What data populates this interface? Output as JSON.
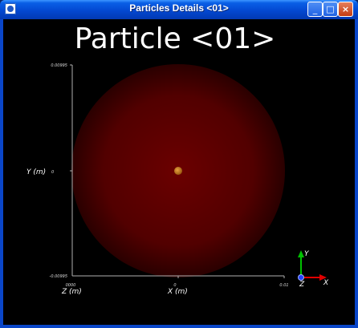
{
  "window": {
    "title": "Particles Details <01>",
    "controls": {
      "minimize": "_",
      "maximize": "□",
      "close": "×"
    }
  },
  "viewport": {
    "heading": "Particle <01>",
    "axes": {
      "y_label": "Y (m)",
      "y_top_tick": "0.00995",
      "y_mid_tick": "0",
      "y_bottom_tick": "-0.00995",
      "x_label": "X (m)",
      "x_mid_tick": "0",
      "x_right_tick": "0.01",
      "z_label": "Z (m)",
      "z_tick": "0000"
    },
    "orientation_gizmo": {
      "y": "Y",
      "z": "Z",
      "x": "X"
    },
    "colors": {
      "sphere_center": "#6b0000",
      "sphere_edge": "#2a0000",
      "marker": "#c87a1a",
      "gizmo_y": "#00c000",
      "gizmo_x": "#e00000",
      "gizmo_z": "#2040ff"
    }
  }
}
